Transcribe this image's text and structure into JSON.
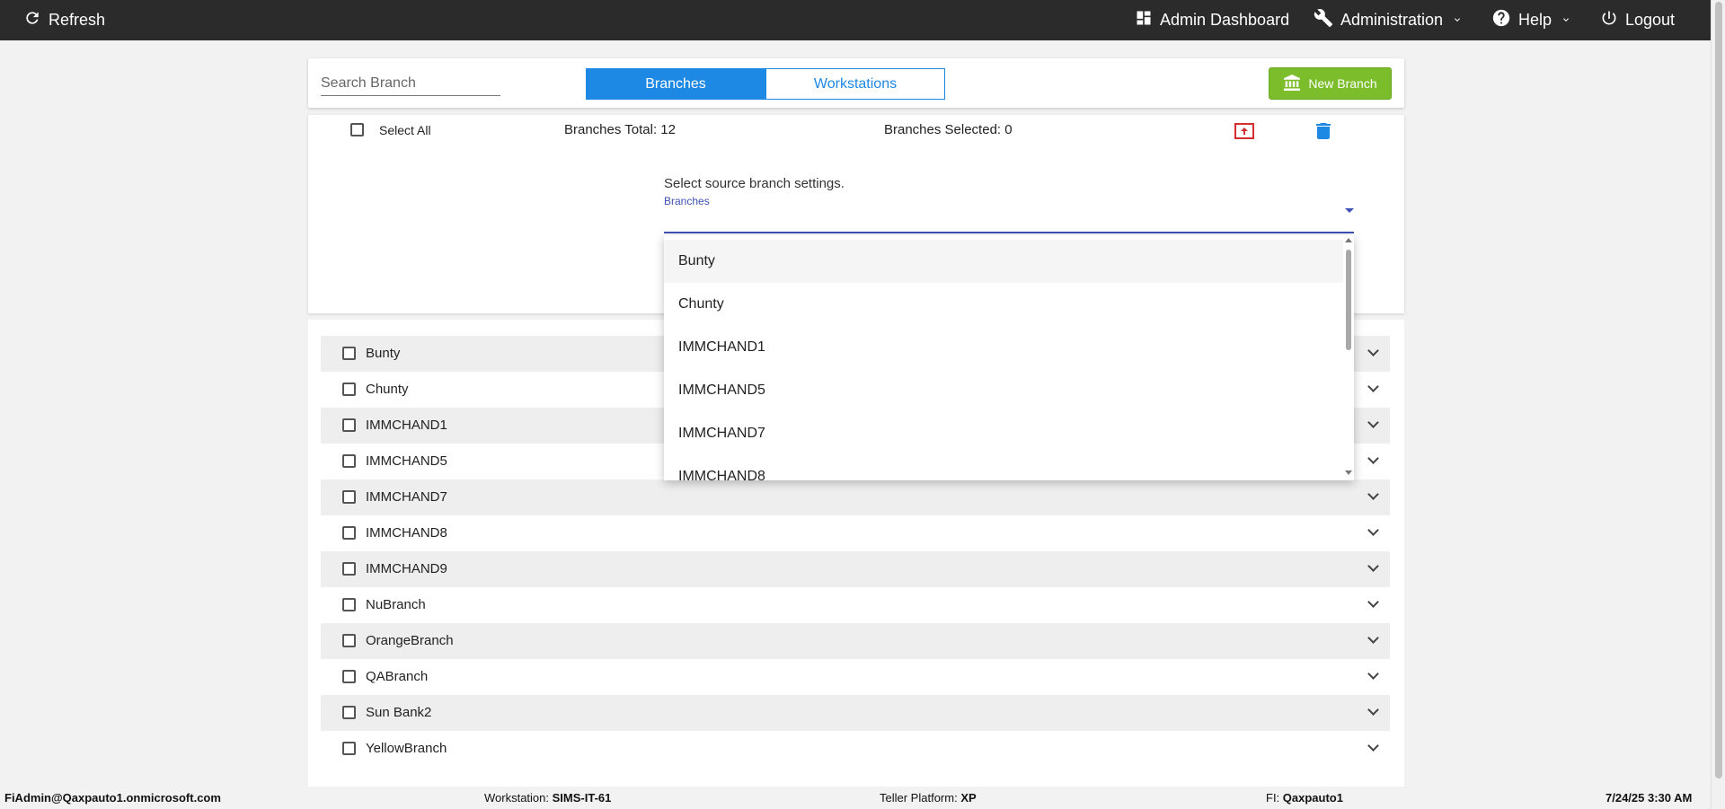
{
  "topbar": {
    "refresh": "Refresh",
    "admin_dashboard": "Admin Dashboard",
    "administration": "Administration",
    "help": "Help",
    "logout": "Logout"
  },
  "toolbar": {
    "search_placeholder": "Search Branch",
    "tabs": [
      {
        "label": "Branches",
        "active": true
      },
      {
        "label": "Workstations",
        "active": false
      }
    ],
    "new_branch": "New Branch"
  },
  "selection": {
    "select_all": "Select All",
    "total_label": "Branches Total: 12",
    "selected_label": "Branches Selected: 0",
    "source_prompt": "Select source branch settings.",
    "dropdown_label": "Branches"
  },
  "dropdown_options": [
    "Bunty",
    "Chunty",
    "IMMCHAND1",
    "IMMCHAND5",
    "IMMCHAND7",
    "IMMCHAND8"
  ],
  "branches": [
    "Bunty",
    "Chunty",
    "IMMCHAND1",
    "IMMCHAND5",
    "IMMCHAND7",
    "IMMCHAND8",
    "IMMCHAND9",
    "NuBranch",
    "OrangeBranch",
    "QABranch",
    "Sun Bank2",
    "YellowBranch"
  ],
  "footer": {
    "user": "FiAdmin@Qaxpauto1.onmicrosoft.com",
    "workstation_label": "Workstation:",
    "workstation_value": "SIMS-IT-61",
    "platform_label": "Teller Platform:",
    "platform_value": "XP",
    "fi_label": "FI:",
    "fi_value": "Qaxpauto1",
    "datetime": "7/24/25 3:30 AM"
  },
  "colors": {
    "topbar_bg": "#2b2b2b",
    "primary": "#1e88e5",
    "success": "#7cbd2c",
    "upload_icon": "#d32f2f",
    "delete_icon": "#1e88e5",
    "dropdown_accent": "#3f51b5"
  }
}
